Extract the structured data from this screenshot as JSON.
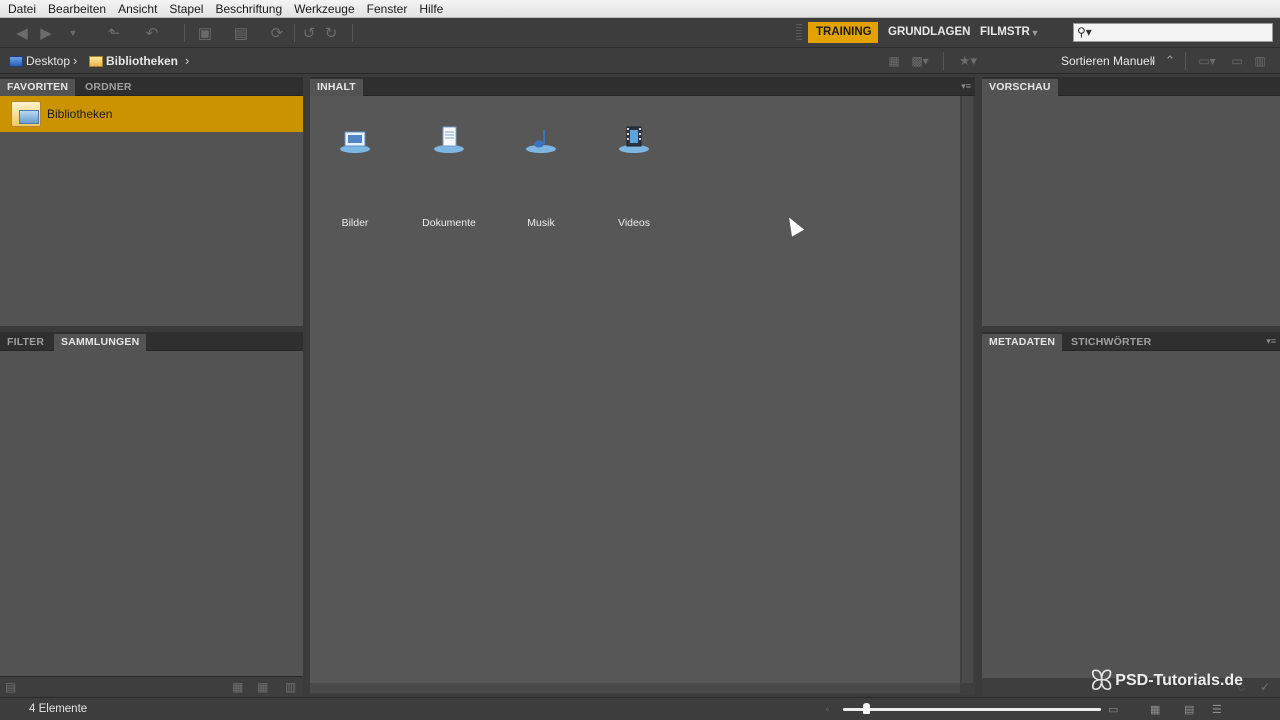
{
  "menu": [
    "Datei",
    "Bearbeiten",
    "Ansicht",
    "Stapel",
    "Beschriftung",
    "Werkzeuge",
    "Fenster",
    "Hilfe"
  ],
  "workspaces": {
    "training": "TRAINING",
    "grundlagen": "GRUNDLAGEN",
    "filmstr": "FILMSTR"
  },
  "search": {
    "value": "",
    "placeholder": ""
  },
  "breadcrumb": [
    {
      "label": "Desktop",
      "icon": "desktop-icon"
    },
    {
      "label": "Bibliotheken",
      "icon": "folder-icon"
    }
  ],
  "sort": {
    "label": "Sortieren Manuell"
  },
  "left_top": {
    "tabs": [
      "FAVORITEN",
      "ORDNER"
    ],
    "items": [
      {
        "label": "Bibliotheken",
        "icon": "libraries-folder-icon",
        "selected": true
      }
    ]
  },
  "left_bottom": {
    "tabs": [
      "FILTER",
      "SAMMLUNGEN"
    ]
  },
  "content": {
    "tab": "INHALT",
    "items": [
      {
        "label": "Bilder",
        "icon": "pictures-library-icon"
      },
      {
        "label": "Dokumente",
        "icon": "documents-library-icon"
      },
      {
        "label": "Musik",
        "icon": "music-library-icon"
      },
      {
        "label": "Videos",
        "icon": "videos-library-icon"
      }
    ]
  },
  "right_top": {
    "tabs": [
      "VORSCHAU"
    ]
  },
  "right_bottom": {
    "tabs": [
      "METADATEN",
      "STICHWÖRTER"
    ]
  },
  "status": {
    "count": "4 Elemente",
    "zoom": 0.09
  },
  "watermark": {
    "text": "PSD-Tutorials.de"
  },
  "colors": {
    "accent": "#e3a200",
    "selection": "#cc9300",
    "panel": "#535353",
    "content": "#575757"
  }
}
